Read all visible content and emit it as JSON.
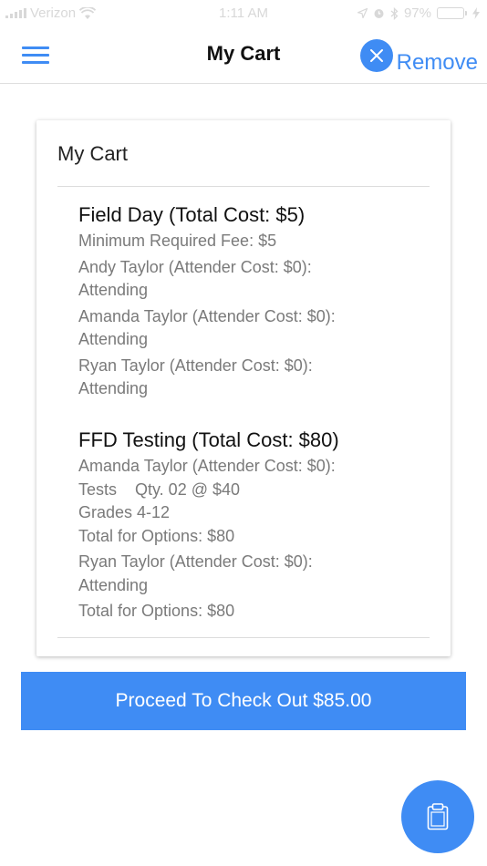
{
  "status_bar": {
    "carrier": "Verizon",
    "time": "1:11 AM",
    "battery": "97%",
    "battery_level": 0.97,
    "battery_color": "#34c759"
  },
  "header": {
    "title": "My Cart",
    "menu_icon": "hamburger-menu-icon",
    "remove_icon": "close-icon",
    "remove_label": "Remove"
  },
  "cart": {
    "title": "My Cart",
    "events": [
      {
        "title": "Field Day (Total Cost: $5)",
        "lines": [
          "Minimum Required Fee: $5",
          "Andy Taylor (Attender Cost: $0):",
          "Attending",
          "Amanda Taylor (Attender Cost: $0):",
          "Attending",
          "Ryan Taylor (Attender Cost: $0):",
          "Attending"
        ]
      },
      {
        "title": "FFD Testing (Total Cost: $80)",
        "lines": [
          "Amanda Taylor (Attender Cost: $0):",
          "Tests    Qty. 02 @ $40",
          "Grades 4-12",
          "Total for Options: $80",
          "Ryan Taylor (Attender Cost: $0):",
          "Attending",
          "Total for Options: $80"
        ]
      }
    ]
  },
  "checkout": {
    "label": "Proceed To Check Out $85.00"
  },
  "fab": {
    "icon": "clipboard-icon"
  },
  "colors": {
    "accent": "#3f8cf4",
    "text_primary": "#111111",
    "text_secondary": "#7a7a7a"
  }
}
